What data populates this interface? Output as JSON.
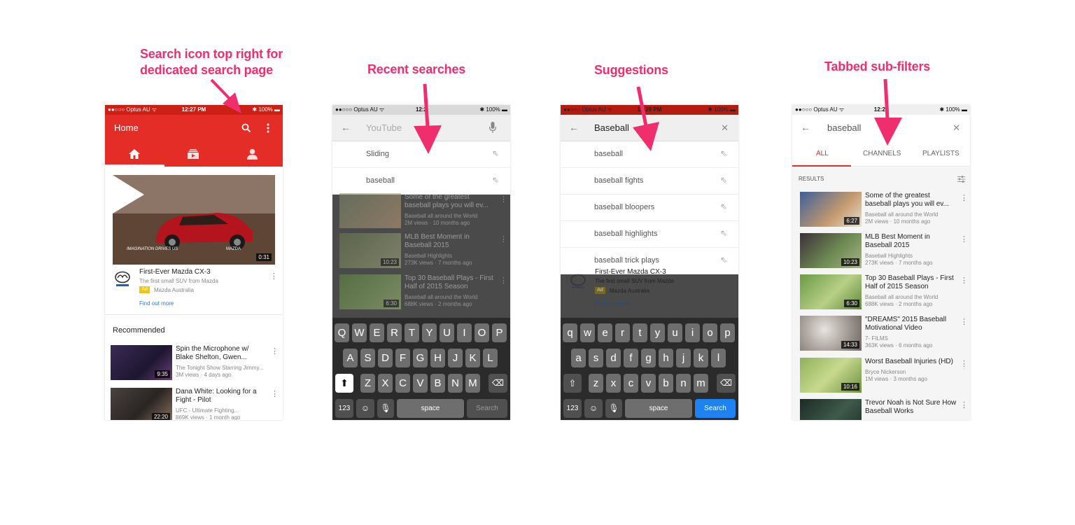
{
  "annotations": {
    "search_icon_line1": "Search icon top right for",
    "search_icon_line2": "dedicated search page",
    "recent": "Recent searches",
    "suggestions": "Suggestions",
    "tabbed": "Tabbed sub-filters"
  },
  "status": {
    "carrier": "●●○○○ Optus AU ᯤ",
    "battery": "✱ 100% ▬",
    "time1": "12:27 PM",
    "time2": "12:2",
    "time3": "12:29 PM",
    "time4": "12:20"
  },
  "home": {
    "title": "Home",
    "ad": {
      "duration": "0:31",
      "title": "First-Ever Mazda CX-3",
      "subtitle": "The first small SUV from Mazda",
      "badge": "Ad",
      "advertiser": "Mazda Australia",
      "link": "Find out more",
      "tagline": "IMAGINATION DRIVES US",
      "brand": "MAZDA"
    },
    "section": "Recommended",
    "videos": [
      {
        "title": "Spin the Microphone w/ Blake Shelton, Gwen...",
        "channel": "The Tonight Show Starring Jimmy...",
        "meta": "3M views · 4 days ago",
        "duration": "9:35"
      },
      {
        "title": "Dana White: Looking for a Fight - Pilot",
        "channel": "UFC - Ultimate Fighting...",
        "meta": "869K views · 1 month ago",
        "duration": "22:20"
      }
    ]
  },
  "recent": {
    "placeholder": "YouTube",
    "items": [
      "Sliding",
      "baseball"
    ]
  },
  "suggest": {
    "query": "Baseball",
    "items": [
      "baseball",
      "baseball fights",
      "baseball bloopers",
      "baseball highlights",
      "baseball trick plays"
    ]
  },
  "keyboard": {
    "row1": [
      "Q",
      "W",
      "E",
      "R",
      "T",
      "Y",
      "U",
      "I",
      "O",
      "P"
    ],
    "row2": [
      "A",
      "S",
      "D",
      "F",
      "G",
      "H",
      "J",
      "K",
      "L"
    ],
    "row3": [
      "Z",
      "X",
      "C",
      "V",
      "B",
      "N",
      "M"
    ],
    "row1_lower": [
      "q",
      "w",
      "e",
      "r",
      "t",
      "y",
      "u",
      "i",
      "o",
      "p"
    ],
    "row2_lower": [
      "a",
      "s",
      "d",
      "f",
      "g",
      "h",
      "j",
      "k",
      "l"
    ],
    "row3_lower": [
      "z",
      "x",
      "c",
      "v",
      "b",
      "n",
      "m"
    ],
    "num": "123",
    "space": "space",
    "search": "Search"
  },
  "results": {
    "query": "baseball",
    "tabs": [
      "ALL",
      "CHANNELS",
      "PLAYLISTS"
    ],
    "label": "RESULTS",
    "videos": [
      {
        "title": "Some of the greatest baseball plays you will ev...",
        "channel": "Baseball all around the World",
        "meta": "2M views · 10 months ago",
        "duration": "6:27"
      },
      {
        "title": "MLB Best Moment in Baseball 2015",
        "channel": "Baseball Highlights",
        "meta": "273K views · 7 months ago",
        "duration": "10:23"
      },
      {
        "title": "Top 30 Baseball Plays - First Half of 2015 Season",
        "channel": "Baseball all around the World",
        "meta": "688K views · 2 months ago",
        "duration": "6:30"
      },
      {
        "title": "\"DREAMS\" 2015 Baseball Motivational Video",
        "channel": "7- FILMS",
        "meta": "363K views · 6 months ago",
        "duration": "14:33"
      },
      {
        "title": "Worst Baseball Injuries (HD)",
        "channel": "Bryce Nickerson",
        "meta": "1M views · 3 months ago",
        "duration": "10:16"
      },
      {
        "title": "Trevor Noah is Not Sure How Baseball Works",
        "channel": "",
        "meta": "",
        "duration": ""
      }
    ]
  },
  "colors": {
    "accent": "#e52d27",
    "annotation": "#f02e6e",
    "search_key": "#1e82f0"
  }
}
